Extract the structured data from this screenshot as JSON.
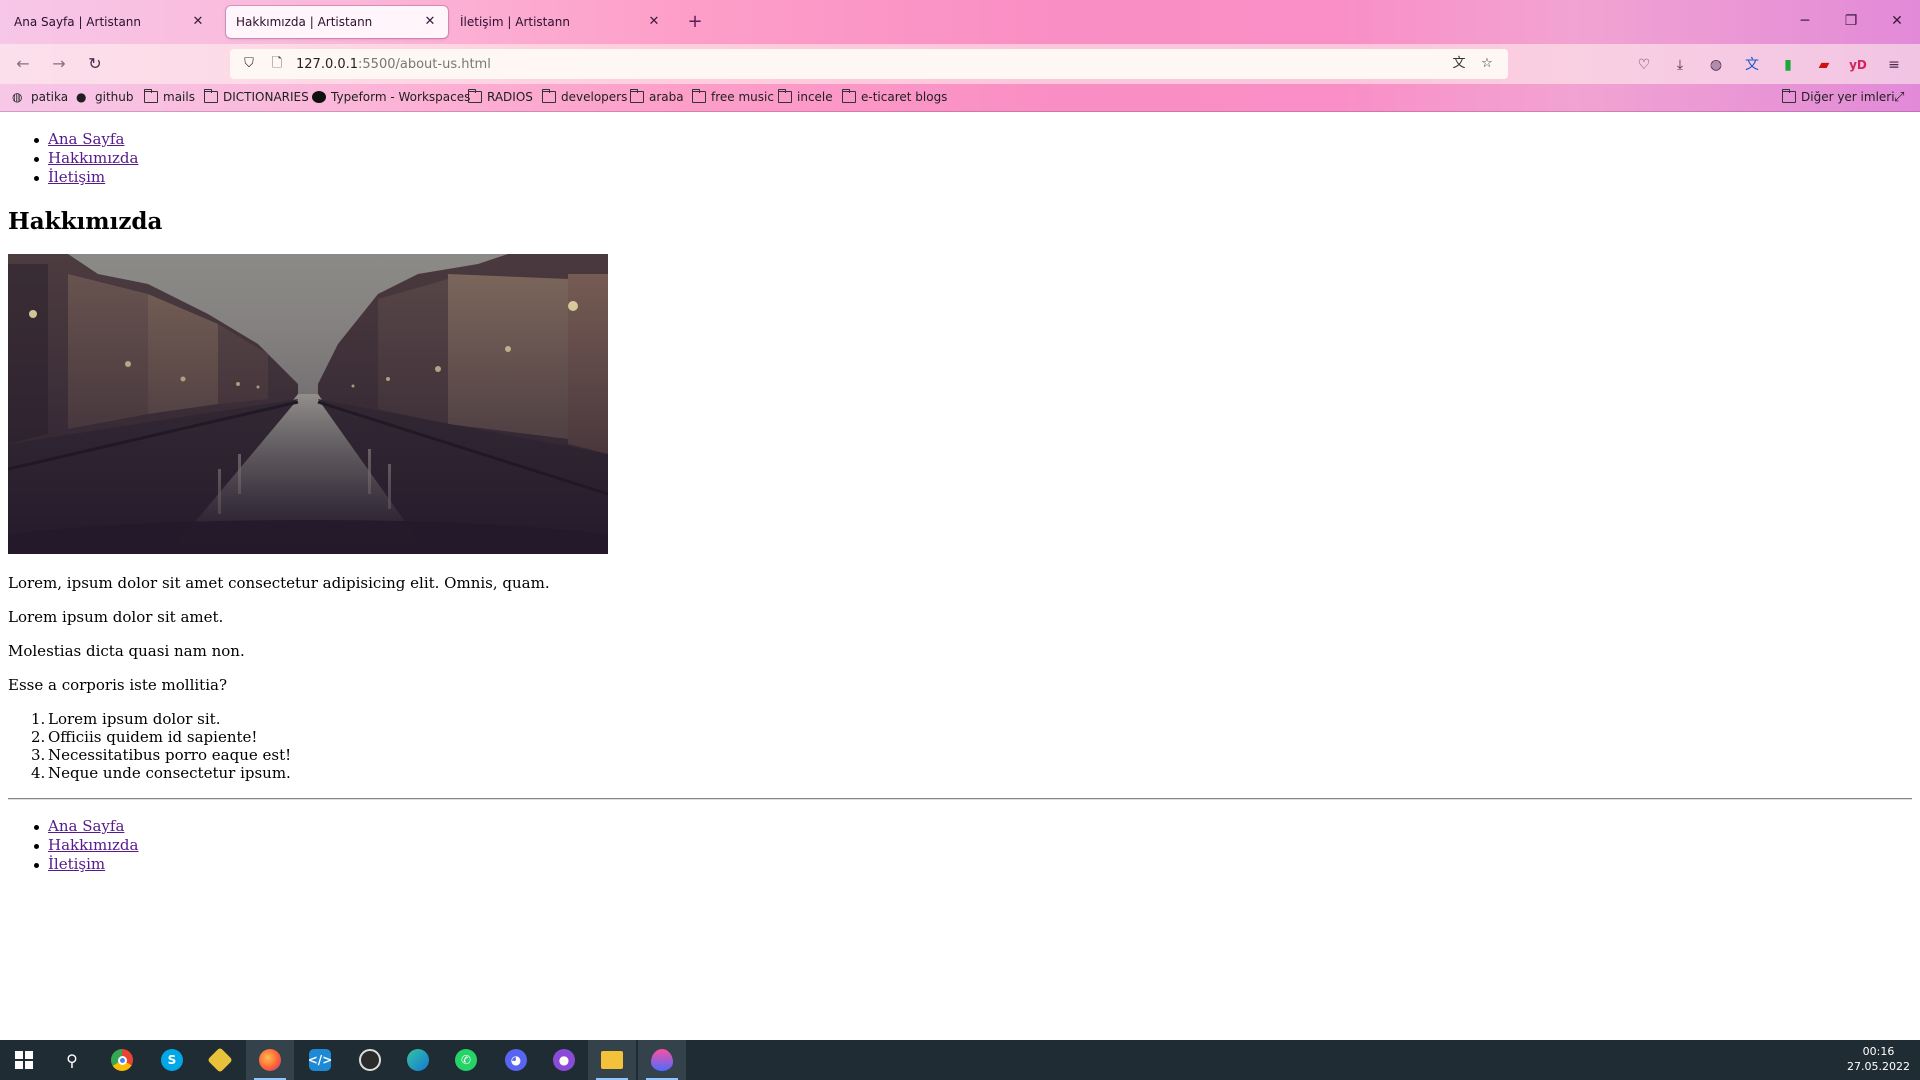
{
  "browser": {
    "tabs": [
      {
        "title": "Ana Sayfa | Artistann",
        "active": false
      },
      {
        "title": "Hakkımızda | Artistann",
        "active": true
      },
      {
        "title": "İletişim | Artistann",
        "active": false
      }
    ],
    "new_tab_icon": "plus-icon",
    "address": {
      "host": "127.0.0.1",
      "rest": ":5500/about-us.html"
    },
    "bookmarks": [
      {
        "label": "patika",
        "icon": "globe-icon"
      },
      {
        "label": "github",
        "icon": "github-icon"
      },
      {
        "label": "mails",
        "icon": "folder-icon"
      },
      {
        "label": "DICTIONARIES",
        "icon": "folder-icon"
      },
      {
        "label": "Typeform - Workspaces",
        "icon": "circle-icon"
      },
      {
        "label": "RADIOS",
        "icon": "folder-icon"
      },
      {
        "label": "developers",
        "icon": "folder-icon"
      },
      {
        "label": "araba",
        "icon": "folder-icon"
      },
      {
        "label": "free music",
        "icon": "folder-icon"
      },
      {
        "label": "incele",
        "icon": "folder-icon"
      },
      {
        "label": "e-ticaret blogs",
        "icon": "folder-icon"
      }
    ],
    "other_bookmarks": "Diğer yer imleri",
    "toolbar_extension_label": "yD"
  },
  "page": {
    "nav_links": [
      "Ana Sayfa",
      "Hakkımızda",
      "İletişim"
    ],
    "title": "Hakkımızda",
    "paragraphs": [
      "Lorem, ipsum dolor sit amet consectetur adipisicing elit. Omnis, quam.",
      "Lorem ipsum dolor sit amet.",
      "Molestias dicta quasi nam non.",
      "Esse a corporis iste mollitia?"
    ],
    "ordered_list": [
      "Lorem ipsum dolor sit.",
      "Officiis quidem id sapiente!",
      "Necessitatibus porro eaque est!",
      "Neque unde consectetur ipsum."
    ],
    "footer_links": [
      "Ana Sayfa",
      "Hakkımızda",
      "İletişim"
    ],
    "link_color": "#551a8b"
  },
  "taskbar": {
    "apps": [
      "start-icon",
      "search-icon",
      "chrome-icon",
      "skype-icon",
      "git-icon",
      "firefox-icon",
      "vscode-icon",
      "obs-icon",
      "edge-icon",
      "whatsapp-icon",
      "discord-icon",
      "github-desktop-icon",
      "file-explorer-icon",
      "paint-drop-icon"
    ],
    "time": "00:16",
    "date": "27.05.2022"
  }
}
